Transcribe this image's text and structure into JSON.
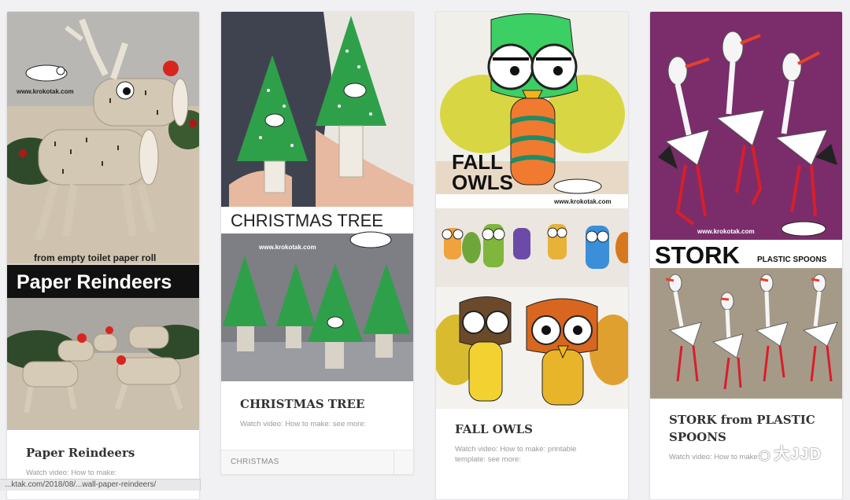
{
  "cards": [
    {
      "title": "Paper Reindeers",
      "meta": "Watch video: How to make:",
      "img_caption_small": "from empty toilet paper roll",
      "img_caption_big": "Paper Reindeers",
      "site": "www.krokotak.com"
    },
    {
      "title": "CHRISTMAS TREE",
      "meta": "Watch video: How to make: see more:",
      "category": "CHRISTMAS",
      "img_caption_big": "CHRISTMAS TREE",
      "site": "www.krokotak.com"
    },
    {
      "title": "FALL OWLS",
      "meta_line1": "Watch video: How to make: printable",
      "meta_line2": "template: see more:",
      "img_caption_big_1": "FALL",
      "img_caption_big_2": "OWLS",
      "site": "www.krokotak.com"
    },
    {
      "title_line1": "STORK from PLASTIC",
      "title_line2": "SPOONS",
      "meta": "Watch video: How to make:",
      "img_caption_big": "STORK",
      "img_caption_small": "PLASTIC SPOONS",
      "site": "www.krokotak.com"
    }
  ],
  "statusbar": "...ktak.com/2018/08/...wall-paper-reindeers/",
  "watermark": "大JJD",
  "icons": {
    "watermark_icon": "wechat-icon"
  }
}
